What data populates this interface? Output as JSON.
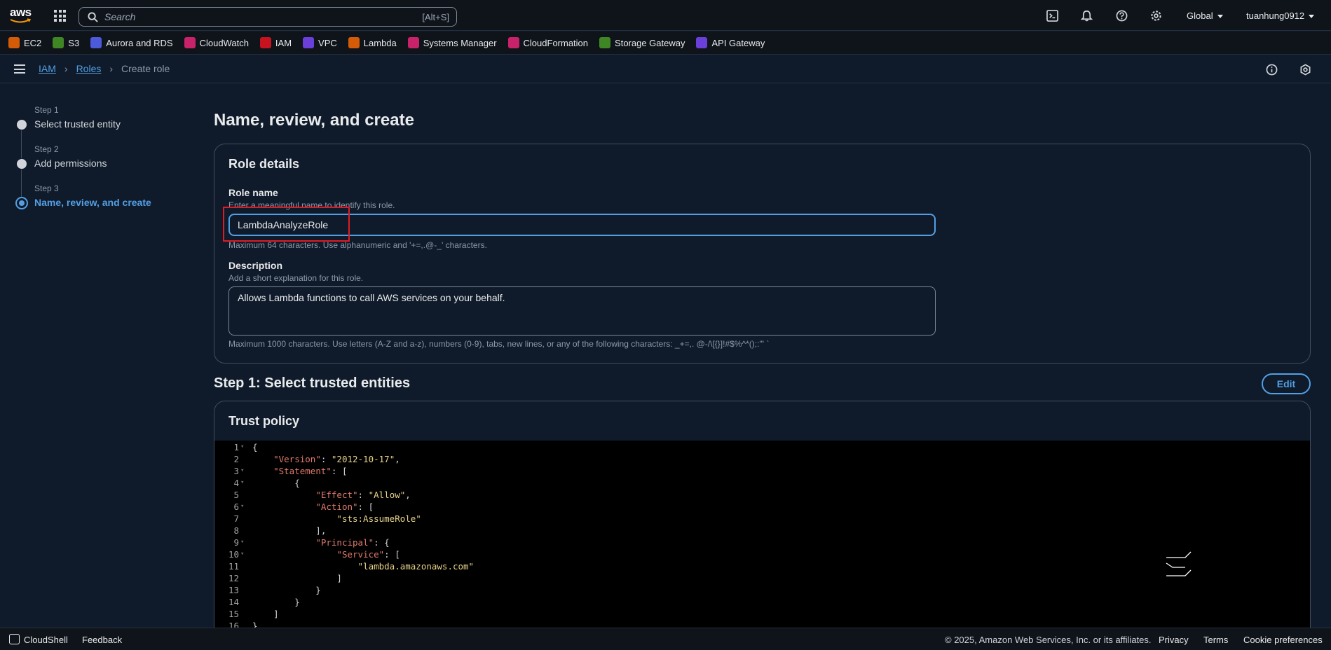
{
  "topnav": {
    "logo_text": "aws",
    "search_placeholder": "Search",
    "search_shortcut": "[Alt+S]",
    "region": "Global",
    "user": "tuanhung0912"
  },
  "favorites": [
    {
      "label": "EC2",
      "color": "#d45b07",
      "icon": "ec2-icon"
    },
    {
      "label": "S3",
      "color": "#3f8624",
      "icon": "s3-icon"
    },
    {
      "label": "Aurora and RDS",
      "color": "#4d5ad9",
      "icon": "rds-icon"
    },
    {
      "label": "CloudWatch",
      "color": "#c7226a",
      "icon": "cloudwatch-icon"
    },
    {
      "label": "IAM",
      "color": "#c7131f",
      "icon": "iam-icon"
    },
    {
      "label": "VPC",
      "color": "#6b3fd9",
      "icon": "vpc-icon"
    },
    {
      "label": "Lambda",
      "color": "#d45b07",
      "icon": "lambda-icon"
    },
    {
      "label": "Systems Manager",
      "color": "#c7226a",
      "icon": "systems-manager-icon"
    },
    {
      "label": "CloudFormation",
      "color": "#c7226a",
      "icon": "cloudformation-icon"
    },
    {
      "label": "Storage Gateway",
      "color": "#3f8624",
      "icon": "storage-gateway-icon"
    },
    {
      "label": "API Gateway",
      "color": "#6b3fd9",
      "icon": "api-gateway-icon"
    }
  ],
  "breadcrumb": {
    "items": [
      "IAM",
      "Roles"
    ],
    "current": "Create role"
  },
  "steps": [
    {
      "label": "Step 1",
      "title": "Select trusted entity"
    },
    {
      "label": "Step 2",
      "title": "Add permissions"
    },
    {
      "label": "Step 3",
      "title": "Name, review, and create"
    }
  ],
  "main": {
    "title": "Name, review, and create",
    "role_details": {
      "title": "Role details",
      "role_name_label": "Role name",
      "role_name_desc": "Enter a meaningful name to identify this role.",
      "role_name_value": "LambdaAnalyzeRole",
      "role_name_hint": "Maximum 64 characters. Use alphanumeric and '+=,.@-_' characters.",
      "description_label": "Description",
      "description_desc": "Add a short explanation for this role.",
      "description_value": "Allows Lambda functions to call AWS services on your behalf.",
      "description_hint": "Maximum 1000 characters. Use letters (A-Z and a-z), numbers (0-9), tabs, new lines, or any of the following characters: _+=,. @-/\\[{}]!#$%^*();:\"' `"
    },
    "step1_section": {
      "title": "Step 1: Select trusted entities",
      "edit_label": "Edit",
      "trust_policy_title": "Trust policy",
      "code_lines": [
        "{",
        "    \"Version\": \"2012-10-17\",",
        "    \"Statement\": [",
        "        {",
        "            \"Effect\": \"Allow\",",
        "            \"Action\": [",
        "                \"sts:AssumeRole\"",
        "            ],",
        "            \"Principal\": {",
        "                \"Service\": [",
        "                    \"lambda.amazonaws.com\"",
        "                ]",
        "            }",
        "        }",
        "    ]",
        "}"
      ]
    }
  },
  "footer": {
    "cloudshell": "CloudShell",
    "feedback": "Feedback",
    "copyright": "© 2025, Amazon Web Services, Inc. or its affiliates.",
    "privacy": "Privacy",
    "terms": "Terms",
    "cookies": "Cookie preferences"
  }
}
